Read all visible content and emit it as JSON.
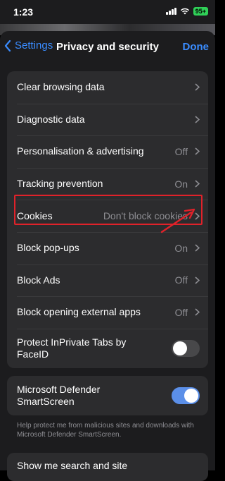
{
  "status": {
    "time": "1:23",
    "battery": "95+"
  },
  "nav": {
    "back_label": "Settings",
    "title": "Privacy and security",
    "done_label": "Done"
  },
  "group1": [
    {
      "label": "Clear browsing data",
      "value": ""
    },
    {
      "label": "Diagnostic data",
      "value": ""
    },
    {
      "label": "Personalisation & advertising",
      "value": "Off"
    },
    {
      "label": "Tracking prevention",
      "value": "On"
    },
    {
      "label": "Cookies",
      "value": "Don't block cookies"
    },
    {
      "label": "Block pop-ups",
      "value": "On"
    },
    {
      "label": "Block Ads",
      "value": "Off"
    },
    {
      "label": "Block opening external apps",
      "value": "Off"
    }
  ],
  "faceid": {
    "label": "Protect InPrivate Tabs by FaceID",
    "enabled": false
  },
  "smartscreen": {
    "label": "Microsoft Defender SmartScreen",
    "enabled": true,
    "footnote": "Help protect me from malicious sites and downloads with Microsoft Defender SmartScreen."
  },
  "partial_row": {
    "label": "Show me search and site"
  },
  "colors": {
    "accent": "#3a8cff",
    "toggle_on": "#5b8fe8",
    "highlight": "#e0222a"
  }
}
